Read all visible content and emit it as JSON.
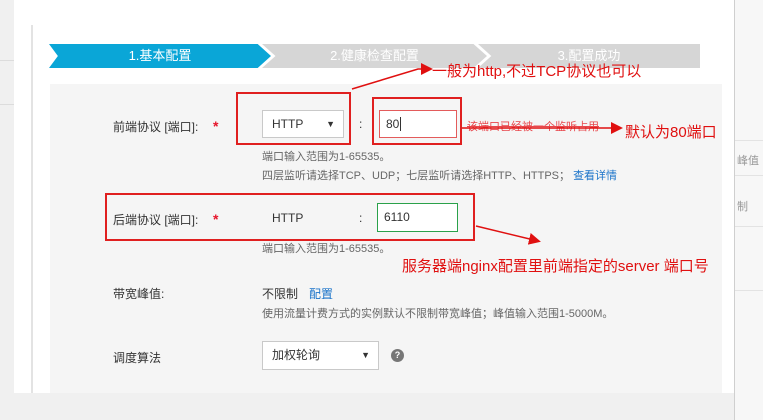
{
  "steps": [
    {
      "label": "1.基本配置",
      "state": "active"
    },
    {
      "label": "2.健康检查配置",
      "state": "inactive"
    },
    {
      "label": "3.配置成功",
      "state": "inactive"
    }
  ],
  "colors": {
    "active_step": "#0aa6d7",
    "inactive_step": "#d6d6d6",
    "required": "#e6152b",
    "link": "#1a73c9",
    "annotation": "#e01010"
  },
  "frontend": {
    "label": "前端协议 [端口]:",
    "required_mark": "*",
    "protocol_value": "HTTP",
    "colon": ":",
    "port_value": "80",
    "port_tip": "该端口已经被一个监听占用",
    "hint_range": "端口输入范围为1-65535。",
    "hint_layers": "四层监听请选择TCP、UDP；七层监听请选择HTTP、HTTPS；",
    "details_link": "查看详情"
  },
  "backend": {
    "label": "后端协议 [端口]:",
    "required_mark": "*",
    "protocol_value": "HTTP",
    "colon": ":",
    "port_value": "6110",
    "hint_range": "端口输入范围为1-65535。"
  },
  "bandwidth": {
    "label": "带宽峰值:",
    "value": "不限制",
    "config_link": "配置",
    "hint": "使用流量计费方式的实例默认不限制带宽峰值；峰值输入范围1-5000M。"
  },
  "scheduler": {
    "label": "调度算法",
    "value": "加权轮询",
    "help_icon": "question-circle-icon"
  },
  "right_strip": {
    "text1": "峰值",
    "text2": "制"
  },
  "annotations": {
    "protocol_note": "一般为http,不过TCP协议也可以",
    "default_port_note": "默认为80端口",
    "backend_note": "服务器端nginx配置里前端指定的server 端口号"
  }
}
